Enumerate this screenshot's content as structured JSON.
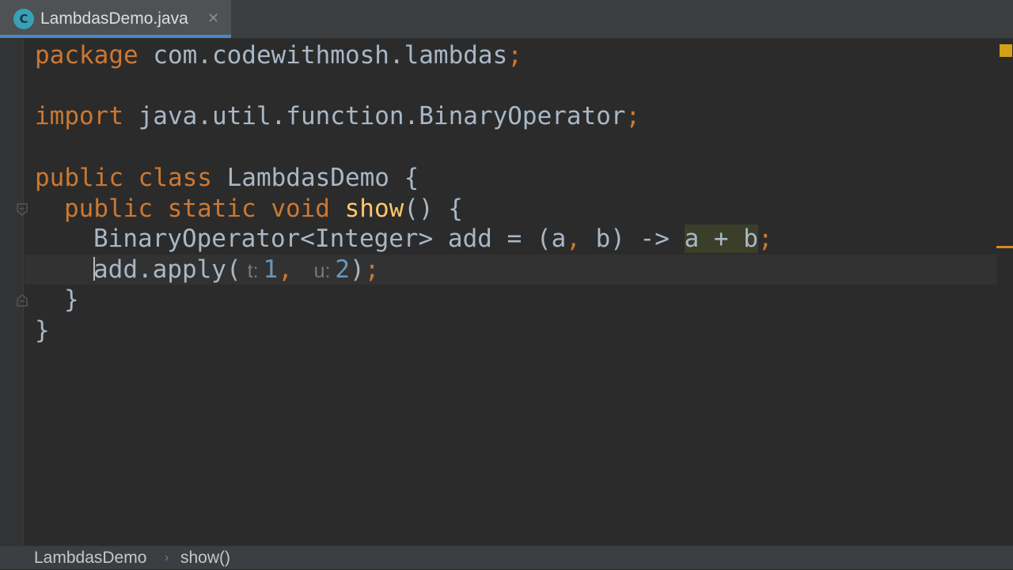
{
  "tab": {
    "icon_letter": "C",
    "label": "LambdasDemo.java",
    "close_glyph": "✕"
  },
  "code": {
    "line1": {
      "kw": "package",
      "rest": " com.codewithmosh.lambdas",
      "semi": ";"
    },
    "line3": {
      "kw": "import",
      "rest": " java.util.function.BinaryOperator",
      "semi": ";"
    },
    "line5": {
      "kw1": "public",
      "kw2": "class",
      "rest": " LambdasDemo {"
    },
    "line6": {
      "kw1": "public",
      "kw2": "static",
      "kw3": "void",
      "fn": "show",
      "rest": "() {"
    },
    "line7": {
      "type": "BinaryOperator<Integer> add = (a",
      "comma": ",",
      "mid": " b) -> ",
      "expr": "a + b",
      "semi": ";"
    },
    "line8": {
      "call": "add.apply(",
      "hint1": "t:",
      "arg1": "1",
      "comma": ",",
      "hint2": "u:",
      "arg2": "2",
      "close": ")",
      "semi": ";"
    },
    "line9": "}",
    "line10": "}"
  },
  "breadcrumb": {
    "items": [
      "LambdasDemo",
      "show()"
    ],
    "separator": "›"
  },
  "colors": {
    "keyword": "#cc7832",
    "method": "#ffc66d",
    "number": "#6897bb",
    "text": "#a9b7c6",
    "background": "#2b2b2b"
  }
}
